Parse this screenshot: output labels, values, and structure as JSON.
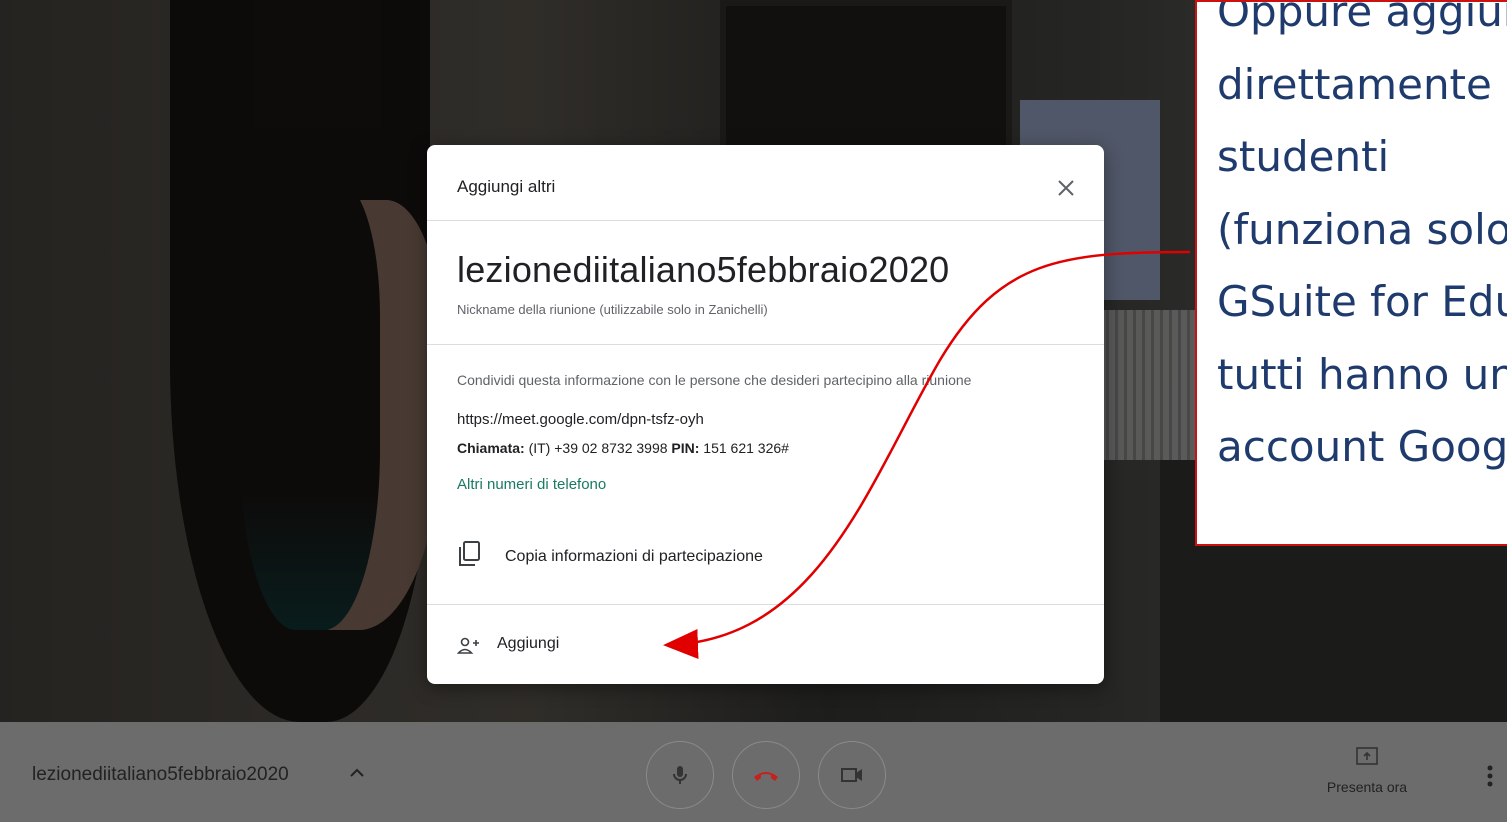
{
  "dialog": {
    "title": "Aggiungi altri",
    "meeting_name": "lezionediitaliano5febbraio2020",
    "nickname_note": "Nickname della riunione (utilizzabile solo in Zanichelli)",
    "share_note": "Condividi questa informazione con le persone che desideri partecipino alla riunione",
    "meet_url": "https://meet.google.com/dpn-tsfz-oyh",
    "call_label": "Chiamata:",
    "call_number": " (IT) +39 02 8732 3998  ",
    "pin_label": "PIN:",
    "pin_value": " 151 621 326#",
    "other_numbers": "Altri numeri di telefono",
    "copy_label": "Copia informazioni di partecipazione",
    "add_label": "Aggiungi"
  },
  "bottombar": {
    "meeting_name": "lezionediitaliano5febbraio2020",
    "present_label": "Presenta ora"
  },
  "annotation": {
    "text": "Oppure aggiungi\ndirettamente gli\nstudenti\n(funziona solo con\nGSuite for Education\ntutti hanno un\naccount Google)"
  },
  "colors": {
    "link": "#1a7a62",
    "end_call": "#c5221f",
    "annotation_border": "#cc1111",
    "annotation_text": "#1f3b6e"
  }
}
